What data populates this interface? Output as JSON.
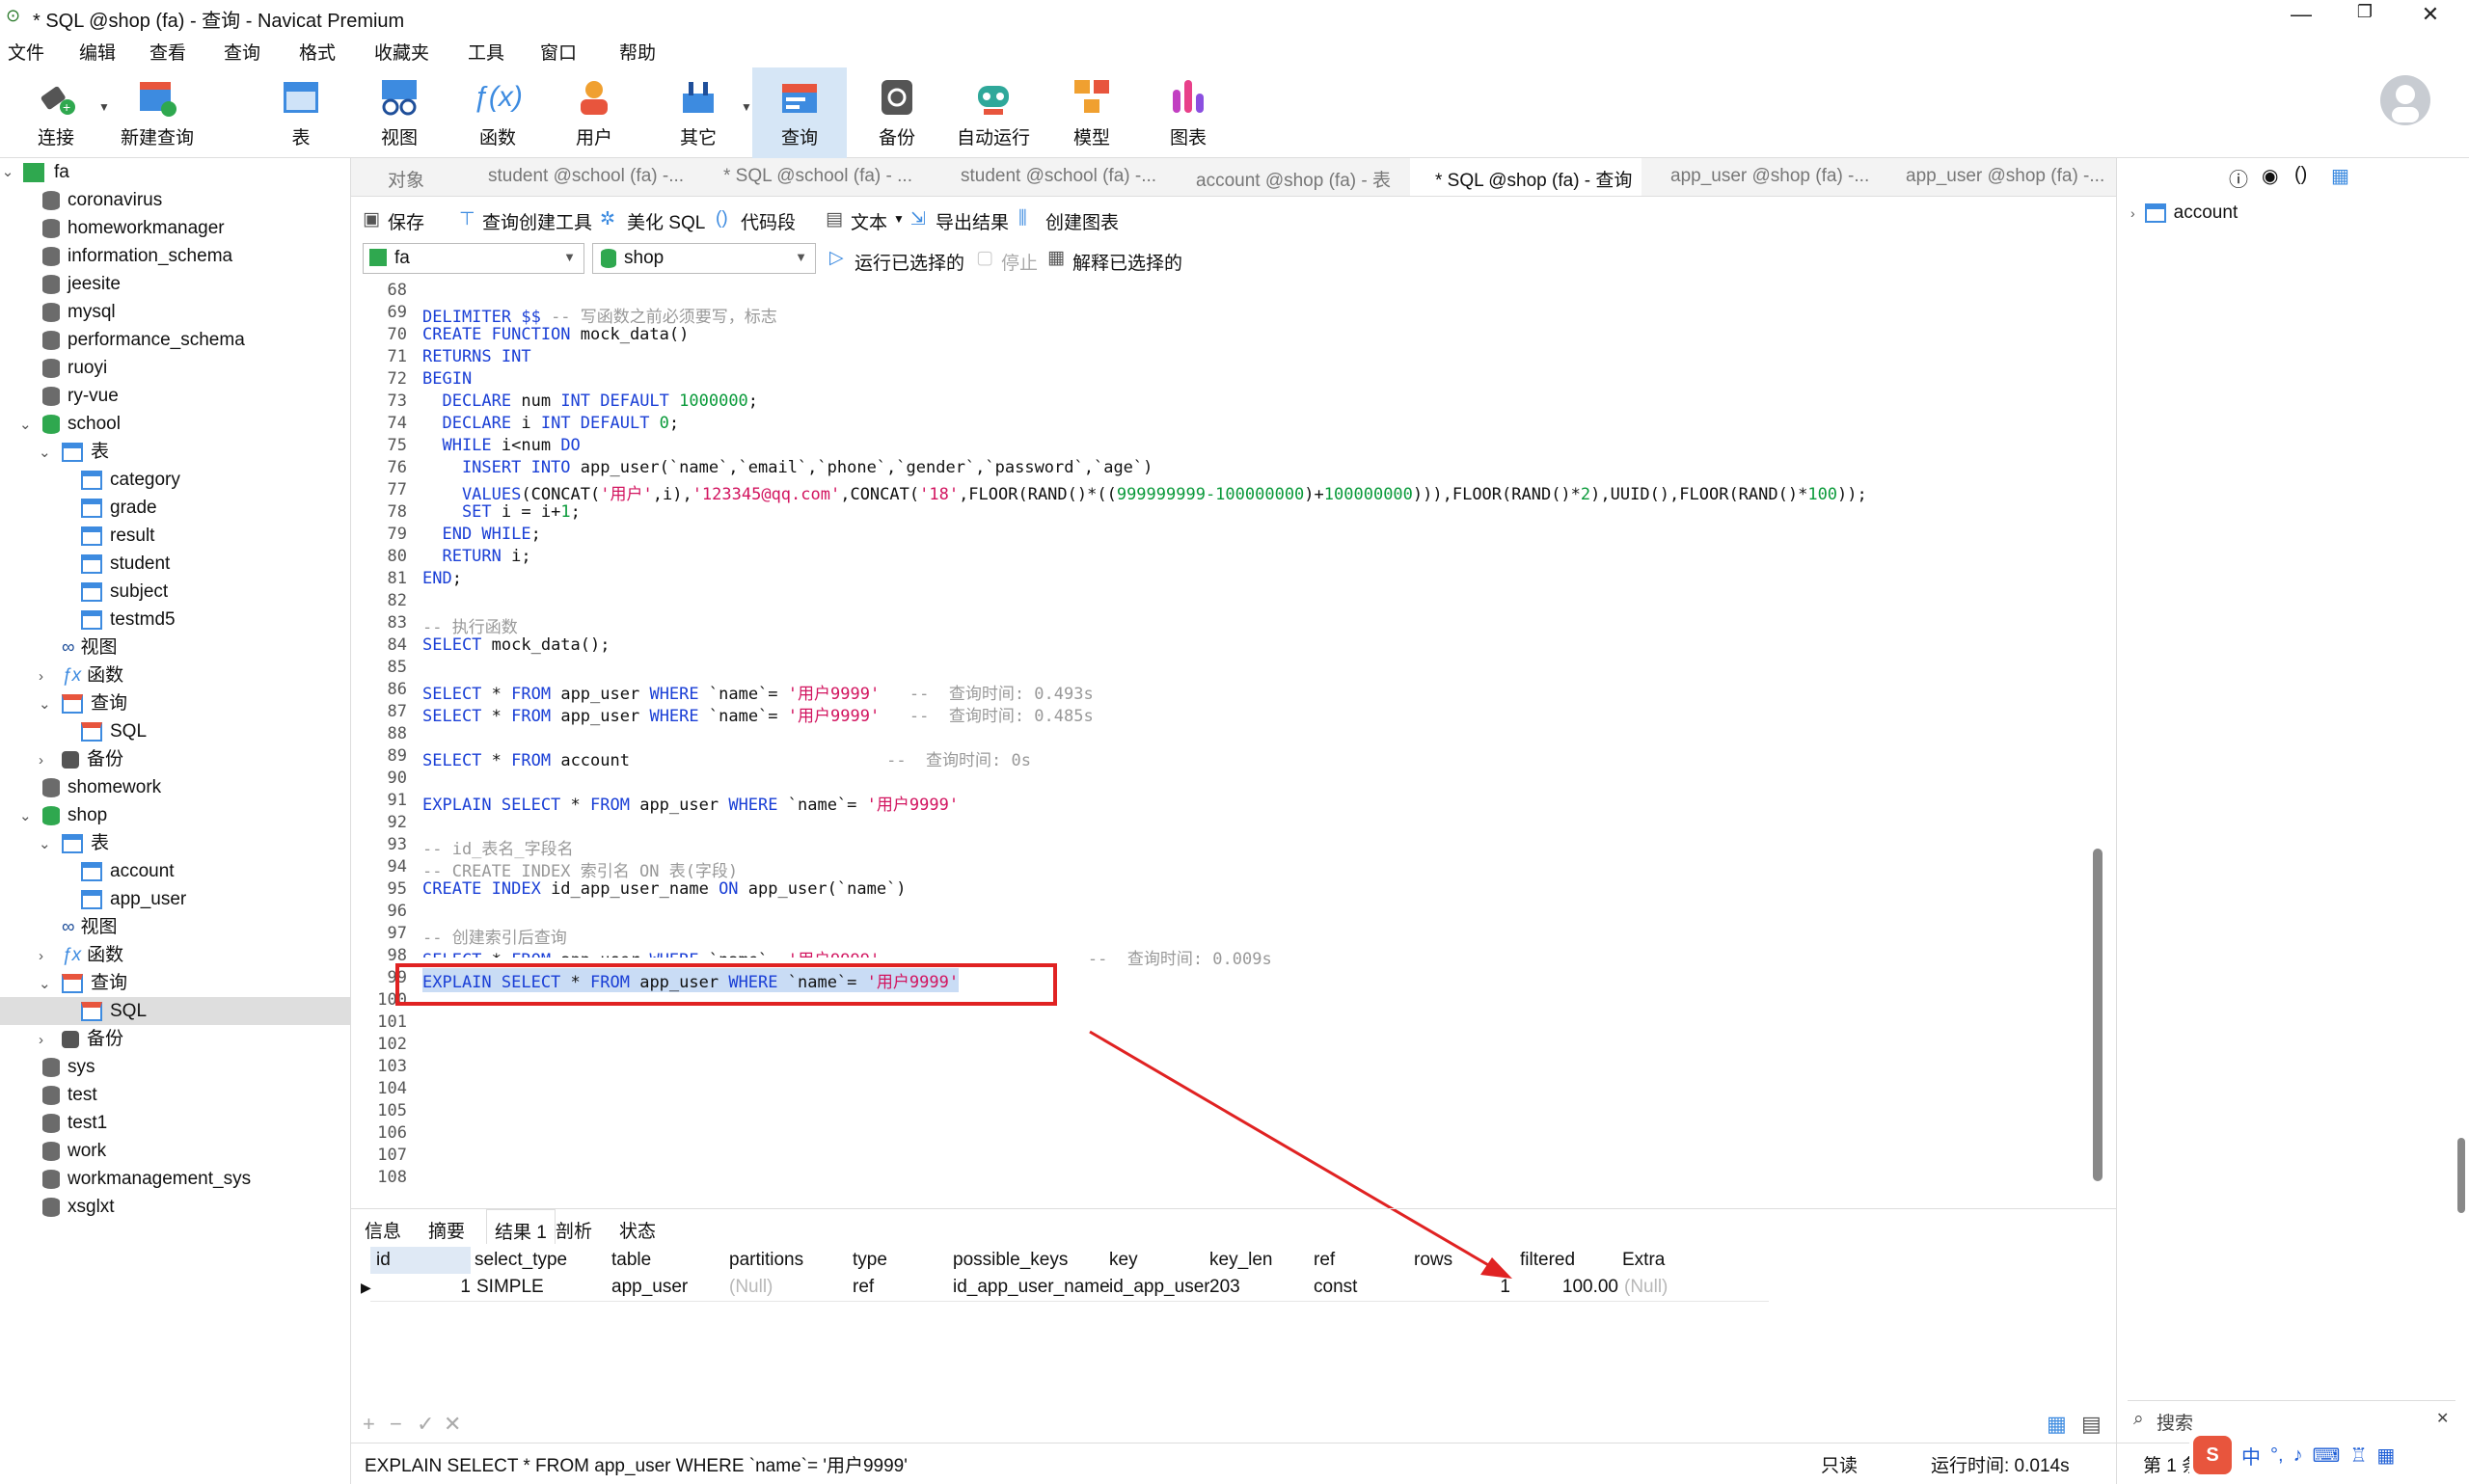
{
  "window": {
    "title": "* SQL @shop (fa) - 查询 - Navicat Premium"
  },
  "menu": [
    "文件",
    "编辑",
    "查看",
    "查询",
    "格式",
    "收藏夹",
    "工具",
    "窗口",
    "帮助"
  ],
  "toolbar": {
    "connect": "连接",
    "new_query": "新建查询",
    "table": "表",
    "view": "视图",
    "function": "函数",
    "user": "用户",
    "other": "其它",
    "query": "查询",
    "backup": "备份",
    "auto_run": "自动运行",
    "model": "模型",
    "chart": "图表"
  },
  "tree": {
    "root": "fa",
    "items_top": [
      "coronavirus",
      "homeworkmanager",
      "information_schema",
      "jeesite",
      "mysql",
      "performance_schema",
      "ruoyi",
      "ry-vue"
    ],
    "school": "school",
    "school_tables_label": "表",
    "school_tables": [
      "category",
      "grade",
      "result",
      "student",
      "subject",
      "testmd5"
    ],
    "view_label": "视图",
    "func_label": "函数",
    "query_label": "查询",
    "sql_label": "SQL",
    "backup_label": "备份",
    "shomework": "shomework",
    "shop": "shop",
    "shop_tables": [
      "account",
      "app_user"
    ],
    "items_bottom": [
      "sys",
      "test",
      "test1",
      "work",
      "workmanagement_sys",
      "xsglxt"
    ]
  },
  "tabs": [
    "对象",
    "student @school (fa) -...",
    "* SQL @school (fa) - ...",
    "student @school (fa) -...",
    "account @shop (fa) - 表",
    "* SQL @shop (fa) - 查询",
    "app_user @shop (fa) -...",
    "app_user @shop (fa) -..."
  ],
  "sql_toolbar": {
    "save": "保存",
    "builder": "查询创建工具",
    "beautify": "美化 SQL",
    "snippet": "代码段",
    "text": "文本",
    "export": "导出结果",
    "create_chart": "创建图表"
  },
  "combos": {
    "connection": "fa",
    "database": "shop",
    "run_selected": "运行已选择的",
    "stop": "停止",
    "explain_selected": "解释已选择的"
  },
  "editor": {
    "line_numbers": [
      "68",
      "69",
      "70",
      "71",
      "72",
      "73",
      "74",
      "75",
      "76",
      "77",
      "78",
      "79",
      "80",
      "81",
      "82",
      "83",
      "84",
      "85",
      "86",
      "87",
      "88",
      "89",
      "90",
      "91",
      "92",
      "93",
      "94",
      "95",
      "96",
      "97",
      "98",
      "99",
      "100",
      "101",
      "102",
      "103",
      "104",
      "105",
      "106",
      "107",
      "108"
    ],
    "l69a": "DELIMITER $$ ",
    "l69b": "-- 写函数之前必须要写，标志",
    "l70a": "CREATE FUNCTION",
    "l70b": " mock_data()",
    "l71": "RETURNS INT",
    "l72": "BEGIN",
    "l73a": "  DECLARE",
    "l73b": " num ",
    "l73c": "INT DEFAULT ",
    "l73d": "1000000",
    "l73e": ";",
    "l74a": "  DECLARE",
    "l74b": " i ",
    "l74c": "INT DEFAULT ",
    "l74d": "0",
    "l74e": ";",
    "l75a": "  WHILE",
    "l75b": " i<num ",
    "l75c": "DO",
    "l76a": "    INSERT INTO",
    "l76b": " app_user(`name`,`email`,`phone`,`gender`,`password`,`age`)",
    "l77a": "    VALUES",
    "l77b": "(CONCAT(",
    "l77c": "'用户'",
    "l77d": ",i),",
    "l77e": "'123345@qq.com'",
    "l77f": ",CONCAT(",
    "l77g": "'18'",
    "l77h": ",FLOOR(RAND()*((",
    "l77i": "999999999-100000000",
    "l77j": ")+",
    "l77k": "100000000",
    "l77l": "))),FLOOR(RAND()*",
    "l77m": "2",
    "l77n": "),UUID(),FLOOR(RAND()*",
    "l77o": "100",
    "l77p": "));",
    "l78a": "    SET",
    "l78b": " i = i+",
    "l78c": "1",
    "l78d": ";",
    "l79a": "  END WHILE",
    "l79b": ";",
    "l80a": "  RETURN",
    "l80b": " i;",
    "l81a": "END",
    "l81b": ";",
    "l83": "-- 执行函数",
    "l84a": "SELECT",
    "l84b": " mock_data();",
    "l86a": "SELECT",
    "l86b": " * ",
    "l86c": "FROM",
    "l86d": " app_user ",
    "l86e": "WHERE",
    "l86f": " `name`= ",
    "l86g": "'用户9999'",
    "l86h": "   --  查询时间: 0.493s",
    "l87h": "   --  查询时间: 0.485s",
    "l89b": " * ",
    "l89d": " account                          ",
    "l89h": "--  查询时间: 0s",
    "l91a": "EXPLAIN SELECT",
    "l93": "-- id_表名_字段名",
    "l94": "-- CREATE INDEX 索引名 ON 表(字段)",
    "l95a": "CREATE INDEX",
    "l95b": " id_app_user_name ",
    "l95c": "ON",
    "l95d": " app_user(`name`)",
    "l97": "-- 创建索引后查询",
    "l98h": "        --  查询时间: 0.009s"
  },
  "result_tabs": [
    "信息",
    "摘要",
    "结果 1",
    "剖析",
    "状态"
  ],
  "grid": {
    "columns": [
      "id",
      "select_type",
      "table",
      "partitions",
      "type",
      "possible_keys",
      "key",
      "key_len",
      "ref",
      "rows",
      "filtered",
      "Extra"
    ],
    "row": [
      "1",
      "SIMPLE",
      "app_user",
      "(Null)",
      "ref",
      "id_app_user_name",
      "id_app_user",
      "203",
      "const",
      "1",
      "100.00",
      "(Null)"
    ]
  },
  "status": {
    "sql": "EXPLAIN SELECT * FROM app_user WHERE `name`= '用户9999'",
    "readonly": "只读",
    "runtime": "运行时间: 0.014s",
    "record": "第 1 条"
  },
  "right_panel": {
    "item": "account",
    "search": "搜索"
  },
  "accent": "#e02222"
}
